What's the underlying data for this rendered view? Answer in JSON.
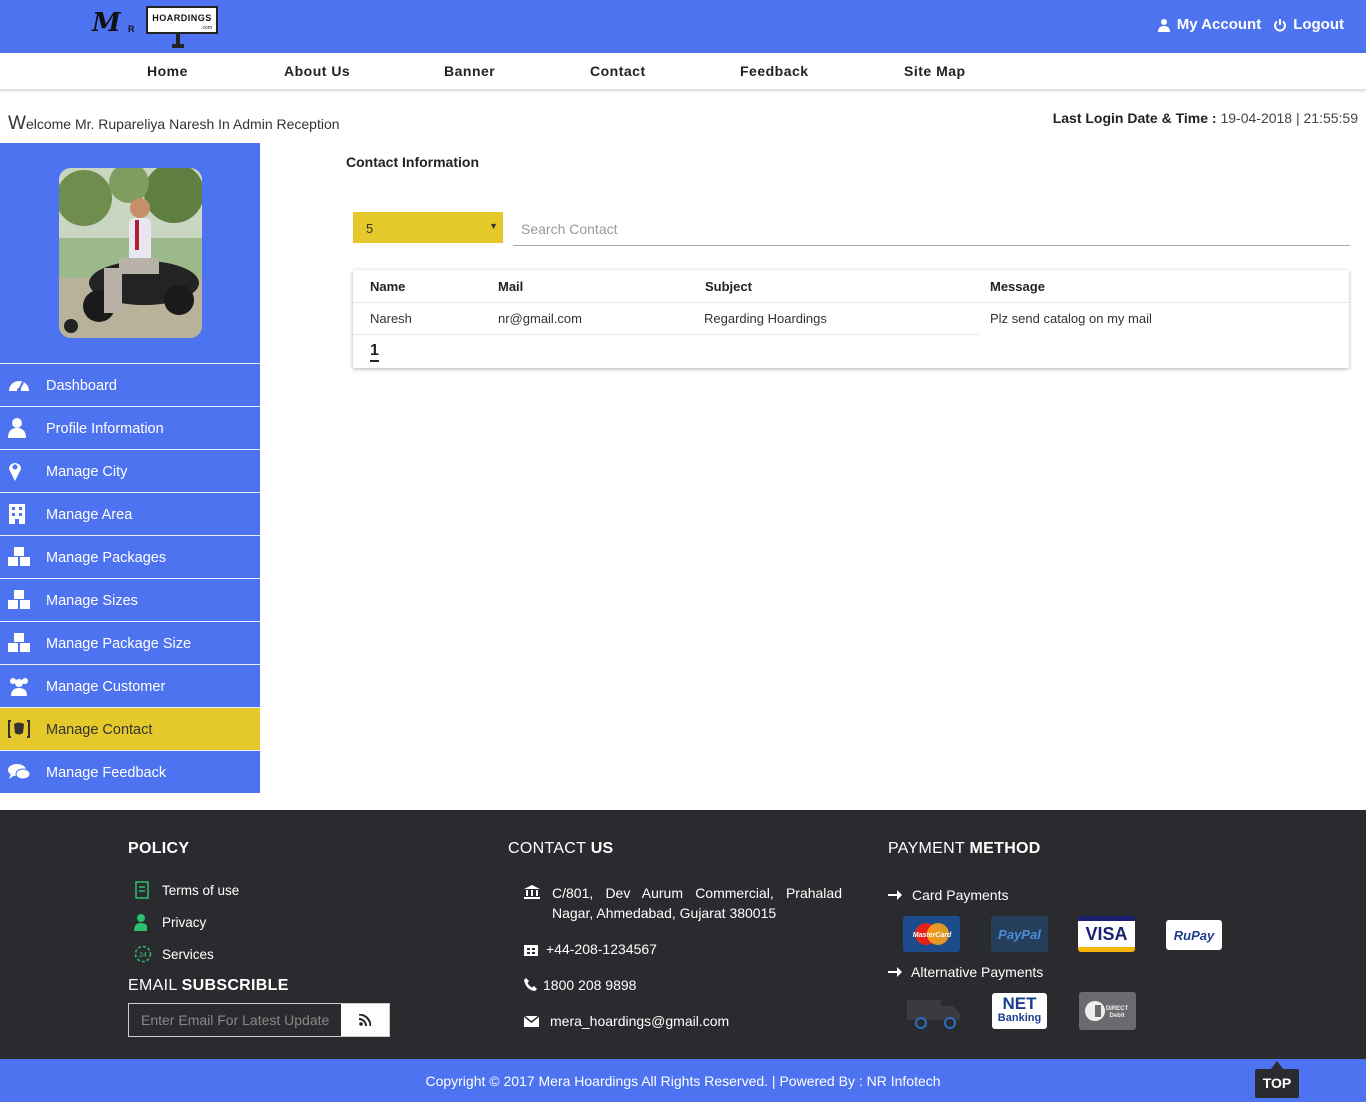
{
  "header": {
    "logo": {
      "letter": "M",
      "sub": "R",
      "board": "HOARDINGS",
      "board_sub": ".com"
    },
    "my_account": "My Account",
    "logout": "Logout"
  },
  "nav": {
    "items": [
      "Home",
      "About Us",
      "Banner",
      "Contact",
      "Feedback",
      "Site Map"
    ]
  },
  "welcome": {
    "first_letter": "W",
    "rest": "elcome Mr. Rupareliya Naresh In Admin Reception"
  },
  "last_login": {
    "label": "Last Login Date & Time :",
    "value": "19-04-2018 | 21:55:59"
  },
  "sidebar": {
    "items": [
      {
        "label": "Dashboard",
        "icon": "dashboard-icon"
      },
      {
        "label": "Profile Information",
        "icon": "user-icon"
      },
      {
        "label": "Manage City",
        "icon": "map-marker-icon"
      },
      {
        "label": "Manage Area",
        "icon": "building-icon"
      },
      {
        "label": "Manage Packages",
        "icon": "cubes-icon"
      },
      {
        "label": "Manage Sizes",
        "icon": "cubes-icon"
      },
      {
        "label": "Manage Package Size",
        "icon": "cubes-icon"
      },
      {
        "label": "Manage Customer",
        "icon": "users-icon"
      },
      {
        "label": "Manage Contact",
        "icon": "contact-card-icon",
        "active": true
      },
      {
        "label": "Manage Feedback",
        "icon": "comments-icon"
      }
    ]
  },
  "main": {
    "title": "Contact Information",
    "page_size": "5",
    "search_placeholder": "Search Contact",
    "table": {
      "headers": [
        "Name",
        "Mail",
        "Subject",
        "Message"
      ],
      "rows": [
        [
          "Naresh",
          "nr@gmail.com",
          "Regarding Hoardings",
          "Plz send catalog on my mail"
        ]
      ]
    },
    "pager": "1"
  },
  "footer": {
    "policy": {
      "title": "POLICY",
      "links": [
        "Terms of use",
        "Privacy",
        "Services"
      ]
    },
    "email": {
      "title_plain": "EMAIL",
      "title_bold": "SUBSCRIBLE",
      "placeholder": "Enter Email For Latest Update"
    },
    "contact": {
      "title_plain": "CONTACT",
      "title_bold": "US",
      "address_line1": "C/801, Dev Aurum Commercial, Prahalad",
      "address_line2": "Nagar, Ahmedabad, Gujarat 380015",
      "fax": "+44-208-1234567",
      "phone": "1800 208 9898",
      "email": "mera_hoardings@gmail.com"
    },
    "payment": {
      "title_plain": "PAYMENT",
      "title_bold": "METHOD",
      "card_label": "Card Payments",
      "alt_label": "Alternative Payments",
      "cards": [
        "MasterCard",
        "PayPal",
        "VISA",
        "RuPay"
      ],
      "alt": [
        "",
        "NET",
        "Banking",
        "DIRECT",
        "Debit"
      ]
    }
  },
  "copyright": "Copyright © 2017 Mera Hoardings All Rights Reserved. | Powered By : NR Infotech",
  "top_button": "TOP",
  "colors": {
    "brand_blue": "#4e73f0",
    "active_yellow": "#e5c92a",
    "footer_dark": "#2a2b2e"
  }
}
